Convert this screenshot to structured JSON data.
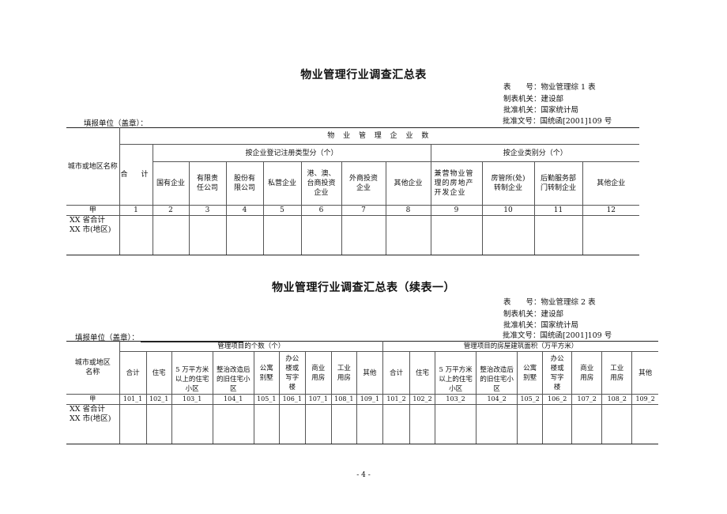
{
  "table1": {
    "title": "物业管理行业调查汇总表",
    "meta": {
      "form_no": "表　　号：物业管理综 1 表",
      "issuer": "制表机关：建设部",
      "approver": "批准机关：国家统计局",
      "approval_no": "批准文号：国统函[2001]109 号"
    },
    "filler_label": "填报单位（盖章）：",
    "header": {
      "row_label": "城市或地区名称",
      "group": "物 业 管 理 企 业 数",
      "total": "合　计",
      "by_registration": "按企业登记注册类型分（个）",
      "by_category": "按企业类别分（个）",
      "registration_cols": [
        "国有企业",
        "有限责任公司",
        "股份有限公司",
        "私营企业",
        "港、澳、台商投资企业",
        "外商投资企业",
        "其他企业"
      ],
      "category_cols": [
        "兼营物业管理的房地产开发企业",
        "房管所(处)转制企业",
        "后勤服务部门转制企业",
        "其他企业"
      ]
    },
    "codes": [
      "甲",
      "1",
      "2",
      "3",
      "4",
      "5",
      "6",
      "7",
      "8",
      "9",
      "10",
      "11",
      "12"
    ],
    "rows": [
      "XX 省合计",
      "XX 市(地区)"
    ]
  },
  "table2": {
    "title": "物业管理行业调查汇总表（续表一）",
    "meta": {
      "form_no": "表　　号：物业管理综 2 表",
      "issuer": "制表机关：建设部",
      "approver": "批准机关：国家统计局",
      "approval_no": "批准文号：国统函[2001]109 号"
    },
    "filler_label": "填报单位（盖章）：",
    "header": {
      "row_label": "城市或地区名称",
      "count_group": "管理项目的个数（个）",
      "area_group": "管理项目的房屋建筑面积（万平方米）",
      "cols": [
        "合计",
        "住宅",
        "5 万平方米以上的住宅小区",
        "整治改造后的旧住宅小区",
        "公寓别墅",
        "办公楼或写字楼",
        "商业用房",
        "工业用房",
        "其他"
      ]
    },
    "codes": [
      "甲",
      "101_1",
      "102_1",
      "103_1",
      "104_1",
      "105_1",
      "106_1",
      "107_1",
      "108_1",
      "109_1",
      "101_2",
      "102_2",
      "103_2",
      "104_2",
      "105_2",
      "106_2",
      "107_2",
      "108_2",
      "109_2"
    ],
    "rows": [
      "XX 省合计",
      "XX 市(地区)"
    ]
  },
  "page_number": "- 4 -"
}
